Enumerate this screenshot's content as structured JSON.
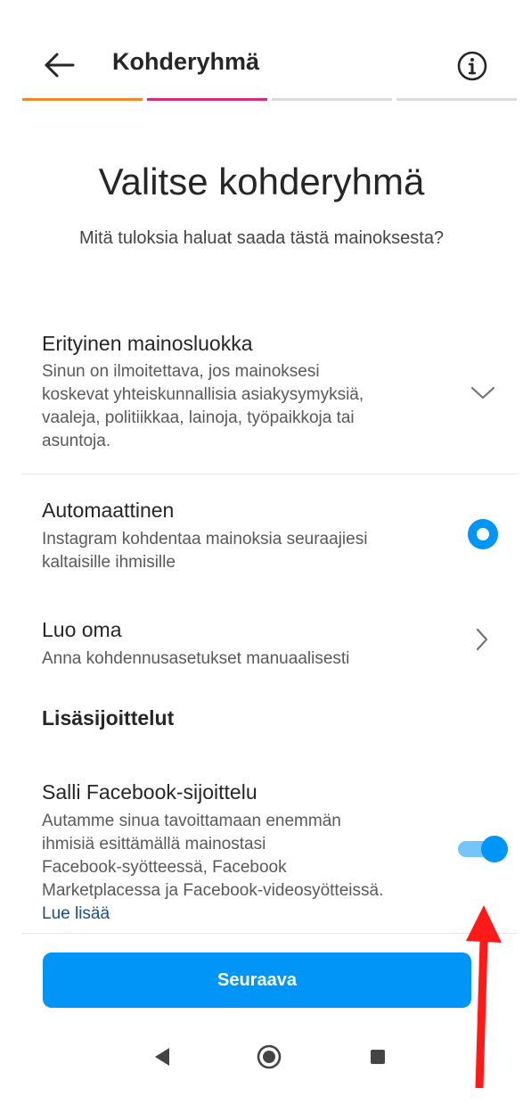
{
  "colors": {
    "accent": "#0095f6",
    "progress_active_1": "#f58529",
    "progress_active_2": "#dd2a7b",
    "annotation_arrow": "#ff1a1a"
  },
  "header": {
    "back_icon": "arrow-left-icon",
    "title": "Kohderyhmä",
    "info_icon": "info-circle-icon"
  },
  "progress": {
    "steps_total": 4,
    "steps_active": 2
  },
  "main": {
    "title": "Valitse kohderyhmä",
    "subtitle": "Mitä tuloksia haluat saada tästä mainoksesta?"
  },
  "special_category": {
    "title": "Erityinen mainosluokka",
    "description": [
      "Sinun on ilmoitettava, jos mainoksesi",
      "koskevat yhteiskunnallisia asiakysymyksiä,",
      "vaaleja, politiikkaa, lainoja, työpaikkoja tai",
      "asuntoja."
    ],
    "icon": "chevron-down-icon"
  },
  "automatic": {
    "title": "Automaattinen",
    "description": [
      "Instagram kohdentaa mainoksia seuraajiesi",
      "kaltaisille ihmisille"
    ],
    "selected": true
  },
  "custom": {
    "title": "Luo oma",
    "description": "Anna kohdennusasetukset manuaalisesti",
    "icon": "chevron-right-icon"
  },
  "placements": {
    "heading": "Lisäsijoittelut",
    "facebook": {
      "title": "Salli Facebook-sijoittelu",
      "description": [
        "Autamme sinua tavoittamaan enemmän",
        "ihmisiä esittämällä mainostasi",
        "Facebook-syötteessä, Facebook",
        "Marketplacessa ja Facebook-videosyötteissä."
      ],
      "learn_more": "Lue lisää",
      "enabled": true
    }
  },
  "footer": {
    "next_label": "Seuraava"
  },
  "navbar": {
    "back_icon": "triangle-back-icon",
    "home_icon": "circle-home-icon",
    "recents_icon": "square-recents-icon"
  }
}
